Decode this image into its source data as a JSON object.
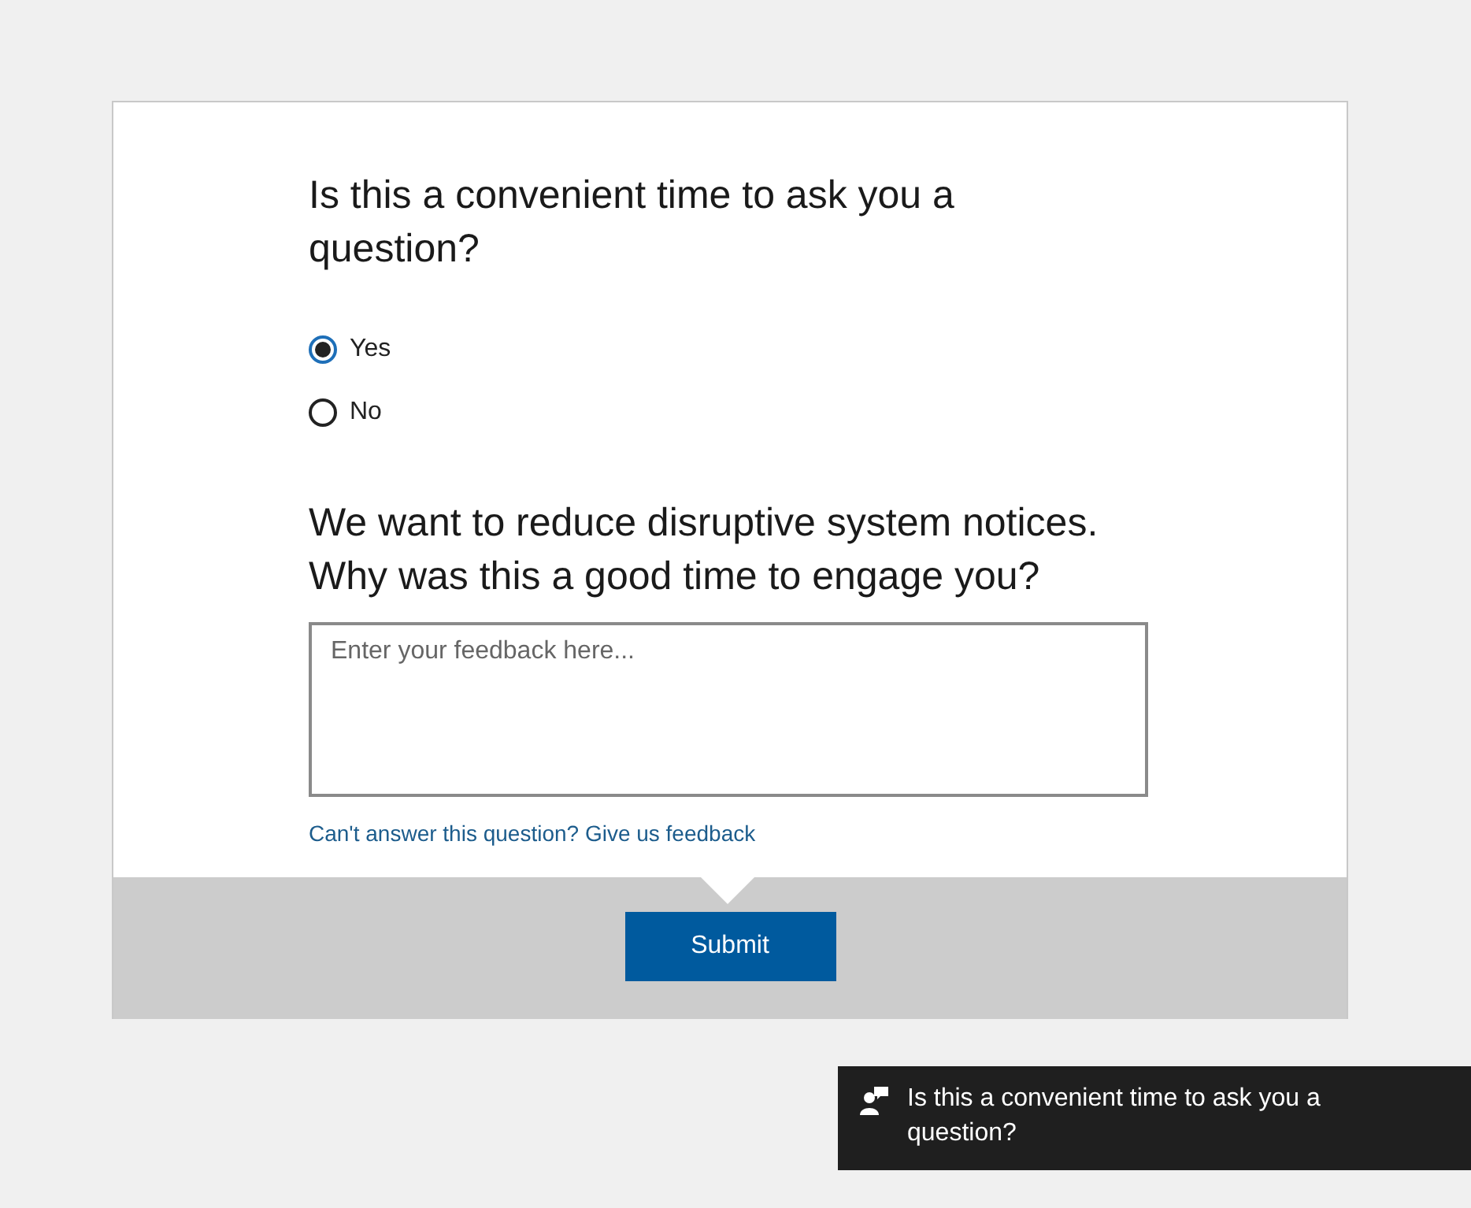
{
  "question": "Is this a convenient time to ask you a question?",
  "options": [
    {
      "label": "Yes",
      "selected": true
    },
    {
      "label": "No",
      "selected": false
    }
  ],
  "follow_up": "We want to reduce disruptive system notices. Why was this a good time to engage you?",
  "feedback": {
    "placeholder": "Enter your feedback here..."
  },
  "link": "Can't answer this question? Give us feedback",
  "submit": "Submit",
  "toast": {
    "text": "Is this a convenient time to ask you a question?"
  }
}
